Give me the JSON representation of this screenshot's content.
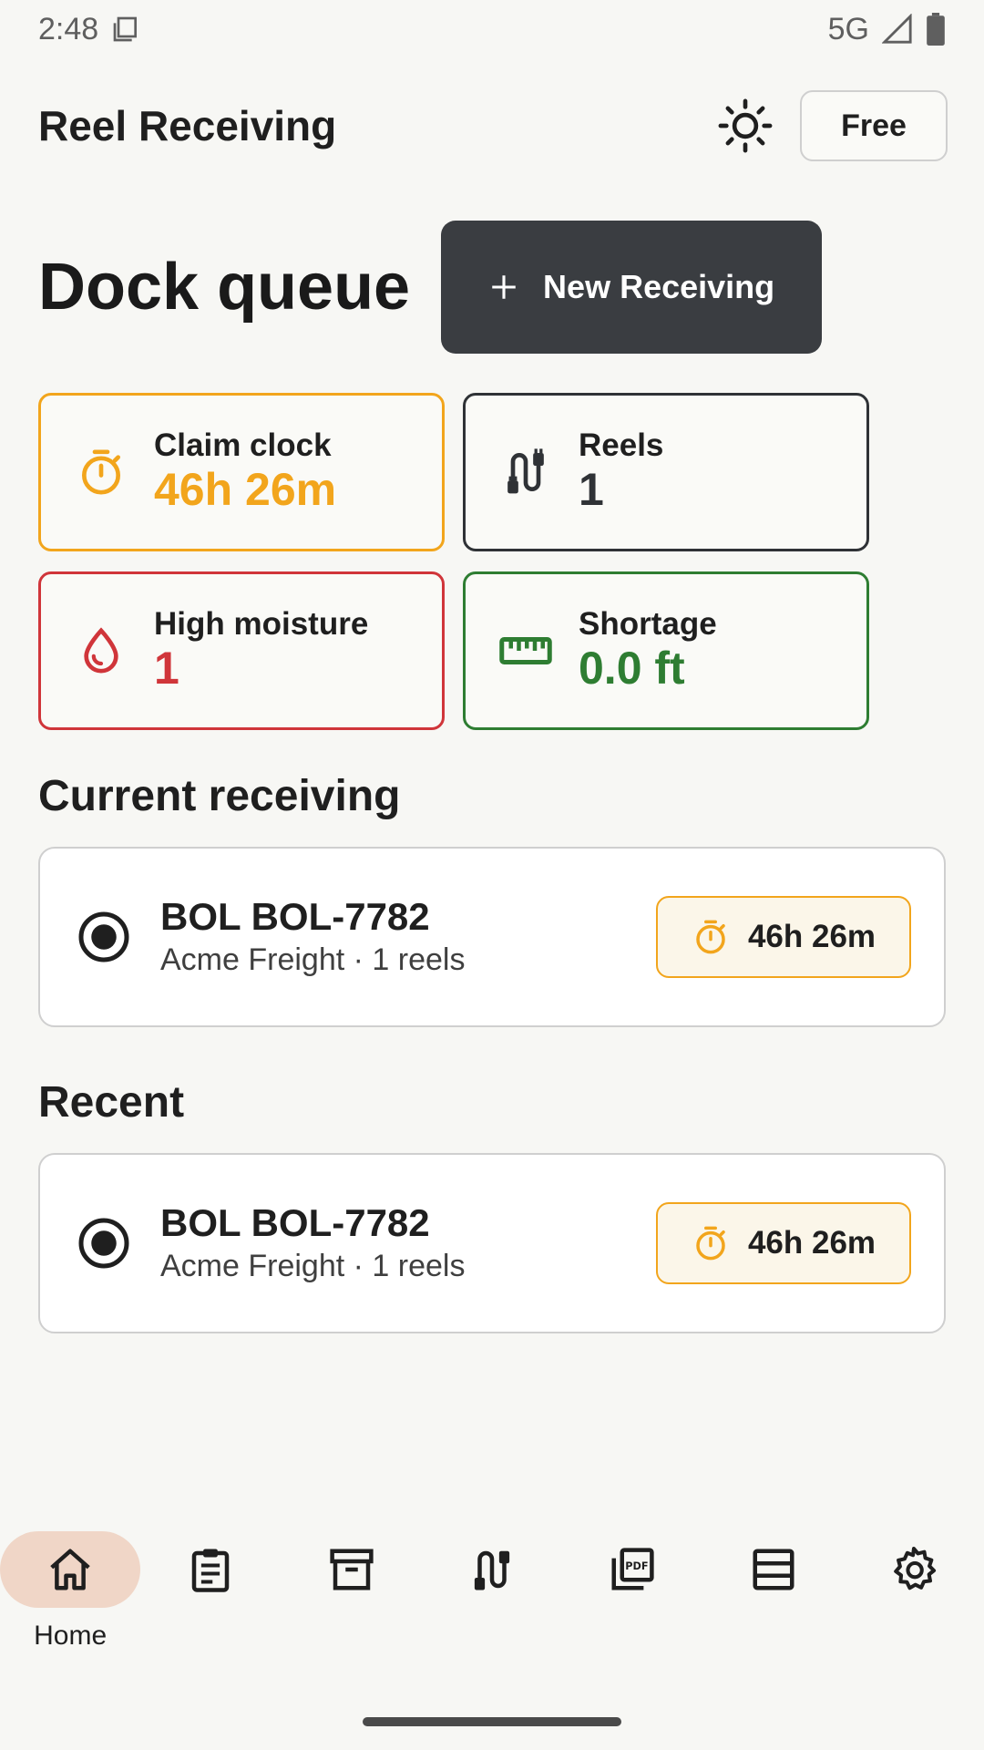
{
  "status_bar": {
    "time": "2:48",
    "network": "5G"
  },
  "app": {
    "title": "Reel Receiving",
    "plan_button": "Free"
  },
  "header": {
    "title": "Dock queue",
    "new_button": "New Receiving"
  },
  "stats": [
    {
      "key": "claim-clock",
      "label": "Claim clock",
      "value": "46h 26m",
      "color": "#f2a51c",
      "icon": "timer-icon"
    },
    {
      "key": "reels",
      "label": "Reels",
      "value": "1",
      "color": "#2f3236",
      "icon": "cable-icon"
    },
    {
      "key": "high-moisture",
      "label": "High moisture",
      "value": "1",
      "color": "#d0353a",
      "icon": "water-drop-icon"
    },
    {
      "key": "shortage",
      "label": "Shortage",
      "value": "0.0 ft",
      "color": "#2e7d32",
      "icon": "ruler-icon"
    }
  ],
  "current": {
    "section_title": "Current receiving",
    "item": {
      "bol": "BOL BOL-7782",
      "subtitle": "Acme Freight · 1 reels",
      "timer": "46h 26m"
    }
  },
  "recent": {
    "section_title": "Recent",
    "item": {
      "bol": "BOL BOL-7782",
      "subtitle": "Acme Freight · 1 reels",
      "timer": "46h 26m"
    }
  },
  "nav": {
    "items": [
      {
        "label": "Home",
        "icon": "home-icon",
        "active": true
      },
      {
        "label": "",
        "icon": "clipboard-icon"
      },
      {
        "label": "",
        "icon": "archive-icon"
      },
      {
        "label": "",
        "icon": "cable-icon"
      },
      {
        "label": "",
        "icon": "pdf-icon"
      },
      {
        "label": "",
        "icon": "list-icon"
      },
      {
        "label": "",
        "icon": "settings-icon"
      }
    ]
  },
  "colors": {
    "accent_orange": "#f2a51c",
    "dark_button": "#3a3d41",
    "nav_active": "#f0d6c7"
  }
}
